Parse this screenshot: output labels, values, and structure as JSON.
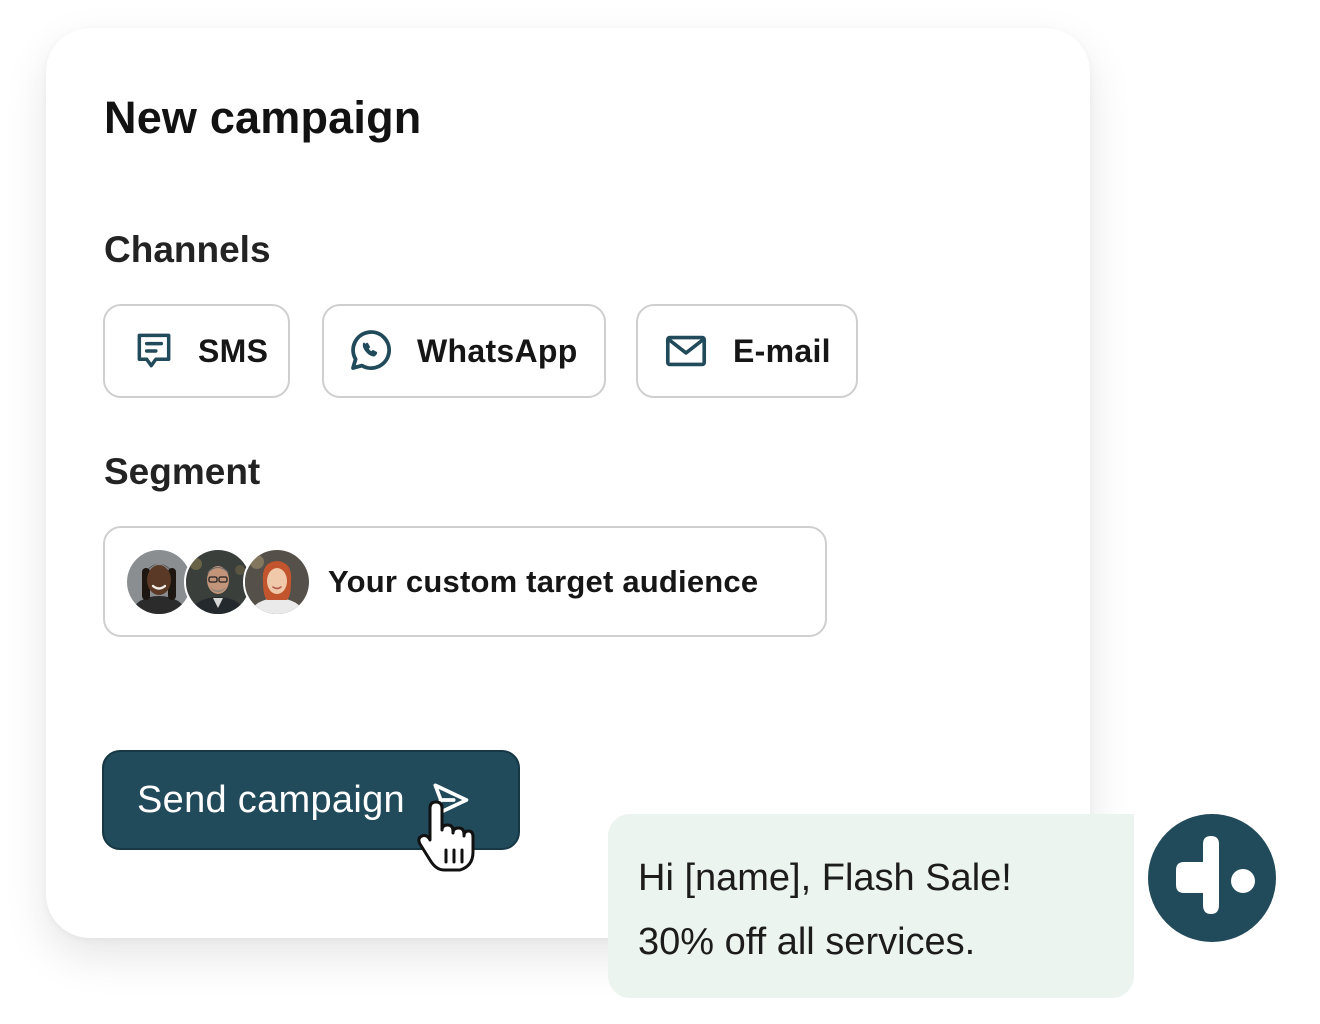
{
  "colors": {
    "primary": "#214a5a",
    "bubble": "#ecf4ef",
    "chip_border": "#cfcfcf"
  },
  "campaign": {
    "title": "New campaign",
    "channels_label": "Channels",
    "channels": [
      {
        "label": "SMS",
        "icon": "sms-message-icon"
      },
      {
        "label": "WhatsApp",
        "icon": "whatsapp-icon"
      },
      {
        "label": "E-mail",
        "icon": "email-envelope-icon"
      }
    ],
    "segment_label": "Segment",
    "segment": {
      "label": "Your custom target audience",
      "avatars": [
        "avatar-man-dreadlocks",
        "avatar-man-glasses",
        "avatar-woman-red-hair"
      ]
    },
    "send_button": {
      "label": "Send campaign",
      "icon": "send-arrow-icon"
    }
  },
  "message_preview": {
    "lines": [
      "Hi [name], Flash Sale!",
      "30% off all services."
    ]
  },
  "brand": {
    "icon": "brand-logo-icon"
  }
}
